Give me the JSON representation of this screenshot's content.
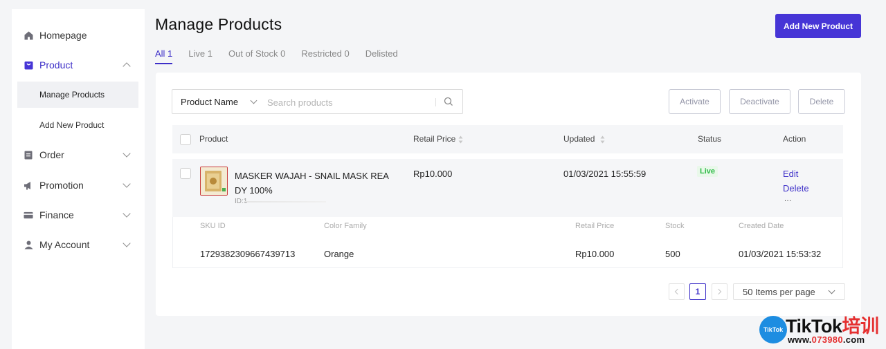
{
  "sidebar": {
    "items": [
      {
        "label": "Homepage",
        "icon": "home-icon"
      },
      {
        "label": "Product",
        "icon": "product-bag-icon",
        "expanded": true
      },
      {
        "label": "Order",
        "icon": "order-icon"
      },
      {
        "label": "Promotion",
        "icon": "megaphone-icon"
      },
      {
        "label": "Finance",
        "icon": "card-icon"
      },
      {
        "label": "My Account",
        "icon": "user-icon"
      }
    ],
    "subitems": [
      {
        "label": "Manage Products",
        "active": true
      },
      {
        "label": "Add New Product"
      }
    ]
  },
  "header": {
    "title": "Manage Products",
    "add_button": "Add New Product"
  },
  "tabs": [
    {
      "label": "All 1",
      "active": true
    },
    {
      "label": "Live 1"
    },
    {
      "label": "Out of Stock 0"
    },
    {
      "label": "Restricted 0"
    },
    {
      "label": "Delisted"
    }
  ],
  "search": {
    "field_select": "Product Name",
    "placeholder": "Search products"
  },
  "bulk_actions": {
    "activate": "Activate",
    "deactivate": "Deactivate",
    "delete": "Delete"
  },
  "table": {
    "columns": {
      "product": "Product",
      "retail_price": "Retail Price",
      "updated": "Updated",
      "status": "Status",
      "action": "Action"
    },
    "rows": [
      {
        "name": "MASKER WAJAH - SNAIL MASK REA DY 100%",
        "id_label": "ID:1",
        "retail_price": "Rp10.000",
        "updated": "01/03/2021 15:55:59",
        "status": "Live",
        "edit": "Edit",
        "delete": "Delete",
        "more": "..."
      }
    ],
    "sku_columns": {
      "sku_id": "SKU ID",
      "color_family": "Color Family",
      "retail_price": "Retail Price",
      "stock": "Stock",
      "created_date": "Created Date"
    },
    "skus": [
      {
        "sku_id": "1729382309667439713",
        "color_family": "Orange",
        "retail_price": "Rp10.000",
        "stock": "500",
        "created_date": "01/03/2021 15:53:32"
      }
    ]
  },
  "pagination": {
    "current_page": "1",
    "per_page": "50 Items per page"
  },
  "watermark": {
    "badge": "TikTok",
    "title_main": "TikTok",
    "title_cn": "培训",
    "url_main": "www.",
    "url_num": "073980",
    "url_tail": ".com"
  },
  "colors": {
    "accent": "#4635d6",
    "live_green": "#2dbb46",
    "background": "#f4f5f7"
  }
}
